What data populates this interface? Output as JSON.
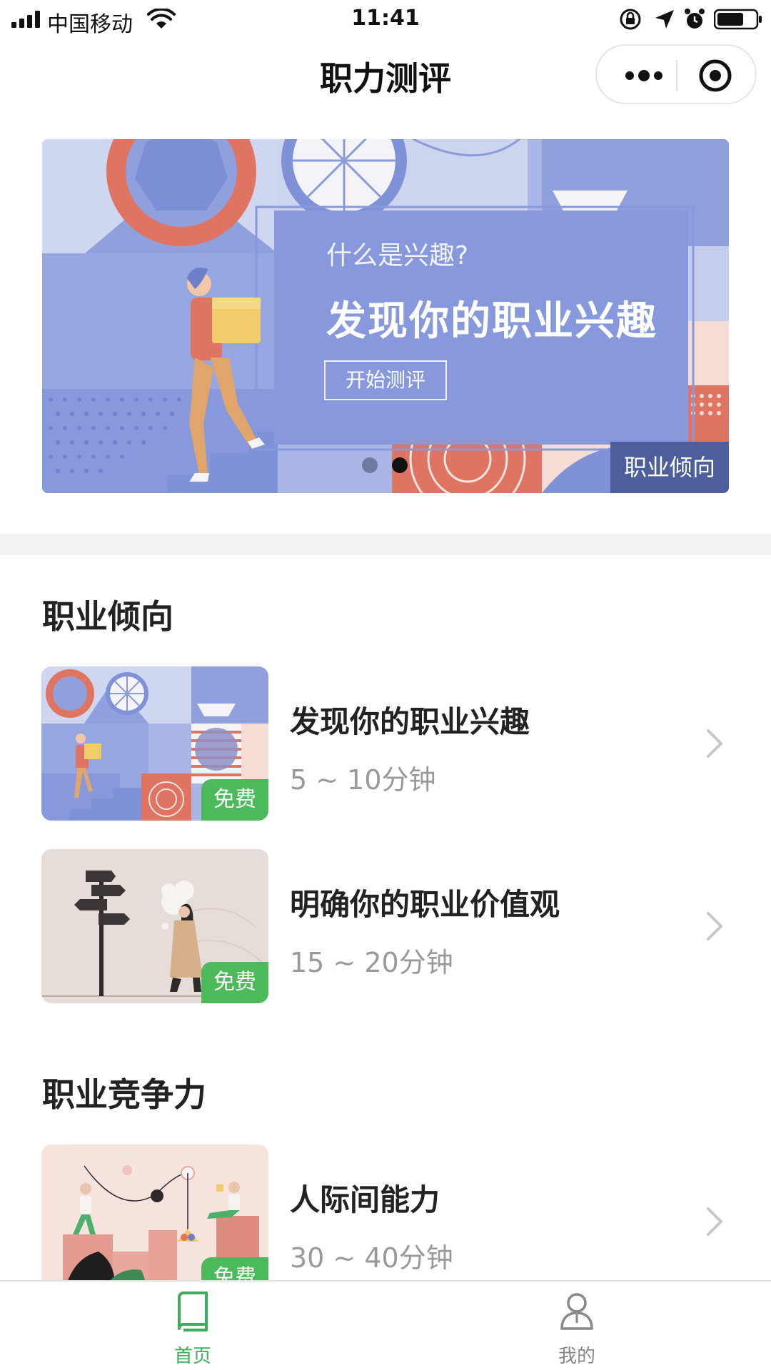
{
  "status_bar": {
    "carrier": "中国移动",
    "time": "11:41"
  },
  "nav": {
    "title": "职力测评"
  },
  "banner": {
    "subtitle": "什么是兴趣?",
    "title": "发现你的职业兴趣",
    "button_label": "开始测评",
    "tag": "职业倾向",
    "active_dot": 2,
    "dot_count": 2
  },
  "sections": [
    {
      "title": "职业倾向",
      "items": [
        {
          "title": "发现你的职业兴趣",
          "duration": "5 ~ 10分钟",
          "badge": "免费"
        },
        {
          "title": "明确你的职业价值观",
          "duration": "15 ~ 20分钟",
          "badge": "免费"
        }
      ]
    },
    {
      "title": "职业竞争力",
      "items": [
        {
          "title": "人际间能力",
          "duration": "30 ~ 40分钟",
          "badge": "免费"
        }
      ]
    }
  ],
  "tab_bar": {
    "items": [
      {
        "label": "首页",
        "icon": "book-icon",
        "active": true
      },
      {
        "label": "我的",
        "icon": "person-icon",
        "active": false
      }
    ]
  },
  "colors": {
    "accent_green": "#4cba5b",
    "tab_active": "#3cad59",
    "banner_blue": "#8799dc",
    "banner_tag": "#4d5e9c"
  }
}
